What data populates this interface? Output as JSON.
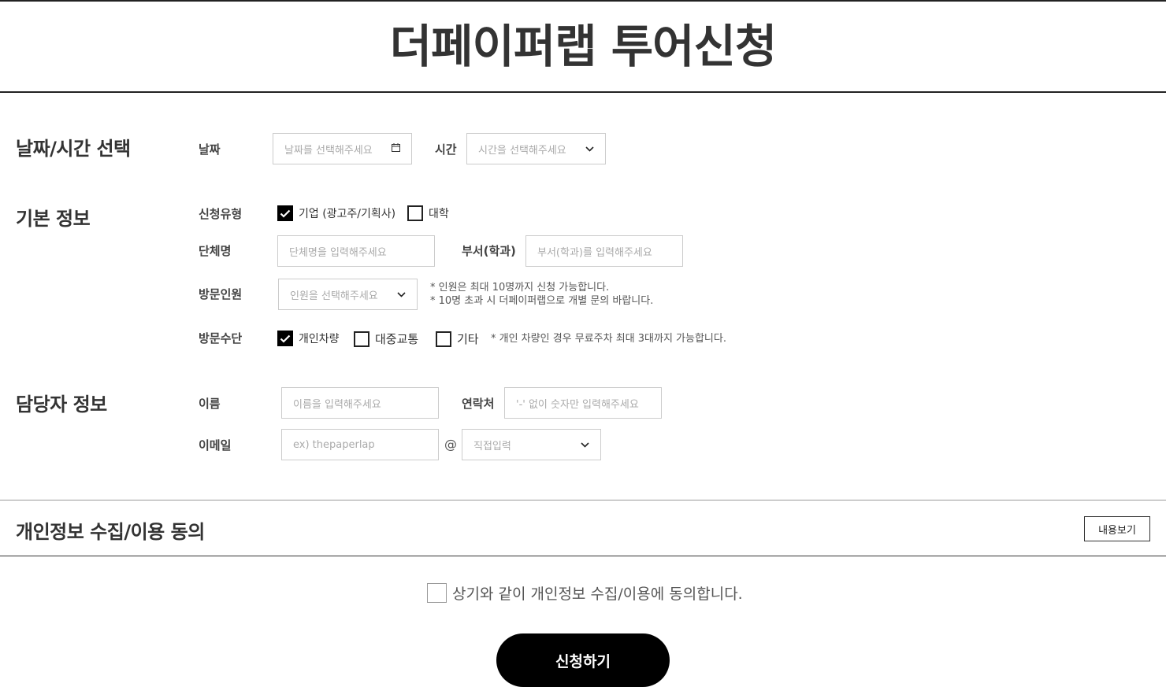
{
  "page": {
    "title": "더페이퍼랩 투어신청"
  },
  "datetime": {
    "section_title": "날짜/시간 선택",
    "date_label": "날짜",
    "date_placeholder": "날짜를 선택해주세요",
    "date_icon": "calendar-icon",
    "time_label": "시간",
    "time_placeholder": "시간을 선택해주세요"
  },
  "basic": {
    "section_title": "기본 정보",
    "type_label": "신청유형",
    "type_options": [
      {
        "label": "기업 (광고주/기획사)",
        "checked": true
      },
      {
        "label": "대학",
        "checked": false
      }
    ],
    "org_label": "단체명",
    "org_placeholder": "단체명을 입력해주세요",
    "dept_label": "부서(학과)",
    "dept_placeholder": "부서(학과)를 입력해주세요",
    "visitors_label": "방문인원",
    "visitors_placeholder": "인원을 선택해주세요",
    "visitors_notes": [
      "* 인원은 최대 10명까지 신청 가능합니다.",
      "* 10명 초과 시 더페이퍼랩으로 개별 문의 바랍니다."
    ],
    "transport_label": "방문수단",
    "transport_options": [
      {
        "label": "개인차량",
        "checked": true
      },
      {
        "label": "대중교통",
        "checked": false
      },
      {
        "label": "기타",
        "checked": false
      }
    ],
    "transport_note": "* 개인 차량인 경우 무료주차 최대 3대까지 가능합니다."
  },
  "manager": {
    "section_title": "담당자 정보",
    "name_label": "이름",
    "name_placeholder": "이름을 입력해주세요",
    "phone_label": "연락처",
    "phone_placeholder": "'-' 없이 숫자만 입력해주세요",
    "email_label": "이메일",
    "email_placeholder": "ex) thepaperlap",
    "at_symbol": "@",
    "domain_placeholder": "직접입력"
  },
  "consent": {
    "section_title": "개인정보 수집/이용 동의",
    "view_button": "내용보기",
    "agree_text": "상기와 같이 개인정보 수집/이용에 동의합니다.",
    "agree_checked": false
  },
  "submit_label": "신청하기",
  "colors": {
    "accent": "#000000",
    "border": "#cccccc",
    "placeholder": "#aaaaaa"
  }
}
